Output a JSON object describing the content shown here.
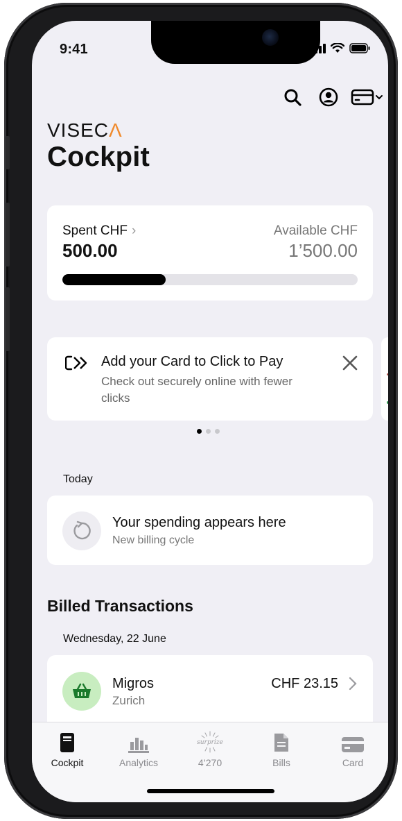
{
  "status_bar": {
    "time": "9:41"
  },
  "top_actions": [
    "search-icon",
    "profile-icon",
    "card-switch-icon"
  ],
  "brand": {
    "prefix": "VISEC",
    "accent": "Λ",
    "accent_color": "#f08a2c"
  },
  "page_title": "Cockpit",
  "spending": {
    "spent_label": "Spent CHF",
    "spent_value": "500.00",
    "available_label": "Available CHF",
    "available_value": "1’500.00",
    "progress_fraction": 0.35
  },
  "promo": {
    "title": "Add your Card to Click to Pay",
    "subtitle": "Check out securely online with fewer clicks",
    "pager_count": 3,
    "pager_active": 0
  },
  "today": {
    "section_label": "Today",
    "empty_title": "Your spending appears here",
    "empty_subtitle": "New billing cycle"
  },
  "billed": {
    "section_title": "Billed Transactions",
    "date_label": "Wednesday, 22 June",
    "transactions": [
      {
        "merchant": "Migros",
        "city": "Zurich",
        "amount": "CHF 23.15",
        "icon": "basket-icon",
        "icon_bg": "#c8edc0"
      }
    ]
  },
  "tabbar": {
    "active": "Cockpit",
    "tabs": [
      {
        "label": "Cockpit",
        "icon": "cockpit-icon"
      },
      {
        "label": "Analytics",
        "icon": "analytics-icon"
      },
      {
        "label": "4’270",
        "icon": "surprize-icon",
        "icon_text": "surprize"
      },
      {
        "label": "Bills",
        "icon": "bills-icon"
      },
      {
        "label": "Card",
        "icon": "card-icon"
      }
    ]
  }
}
